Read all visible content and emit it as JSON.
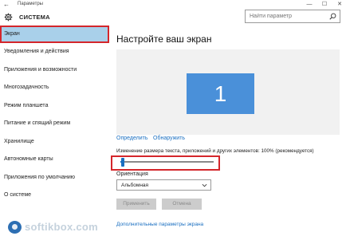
{
  "window": {
    "title": "Параметры",
    "minimize": "—",
    "maximize": "☐",
    "close": "✕"
  },
  "sidebar": {
    "section_title": "СИСТЕМА",
    "items": [
      {
        "label": "Экран",
        "active": true
      },
      {
        "label": "Уведомления и действия"
      },
      {
        "label": "Приложения и возможности"
      },
      {
        "label": "Многозадачность"
      },
      {
        "label": "Режим планшета"
      },
      {
        "label": "Питание и спящий режим"
      },
      {
        "label": "Хранилище"
      },
      {
        "label": "Автономные карты"
      },
      {
        "label": "Приложения по умолчанию"
      },
      {
        "label": "О системе"
      }
    ]
  },
  "search": {
    "placeholder": "Найти параметр"
  },
  "main": {
    "title": "Настройте ваш экран",
    "monitor_number": "1",
    "identify_link": "Определить",
    "detect_link": "Обнаружить",
    "scale_label": "Изменение размера текста, приложений и других элементов: 100% (рекомендуется)",
    "scale_slider_level": 0.02,
    "orientation_label": "Ориентация",
    "orientation_value": "Альбомная",
    "apply_button": "Применить",
    "cancel_button": "Отмена",
    "advanced_link": "Дополнительные параметры экрана"
  },
  "watermark": {
    "text": "softikbox.com"
  },
  "colors": {
    "accent": "#1a6fc1",
    "active_item_bg": "#a9d0ea",
    "highlight_frame": "#d4262b",
    "monitor_tile": "#4a90d9"
  }
}
